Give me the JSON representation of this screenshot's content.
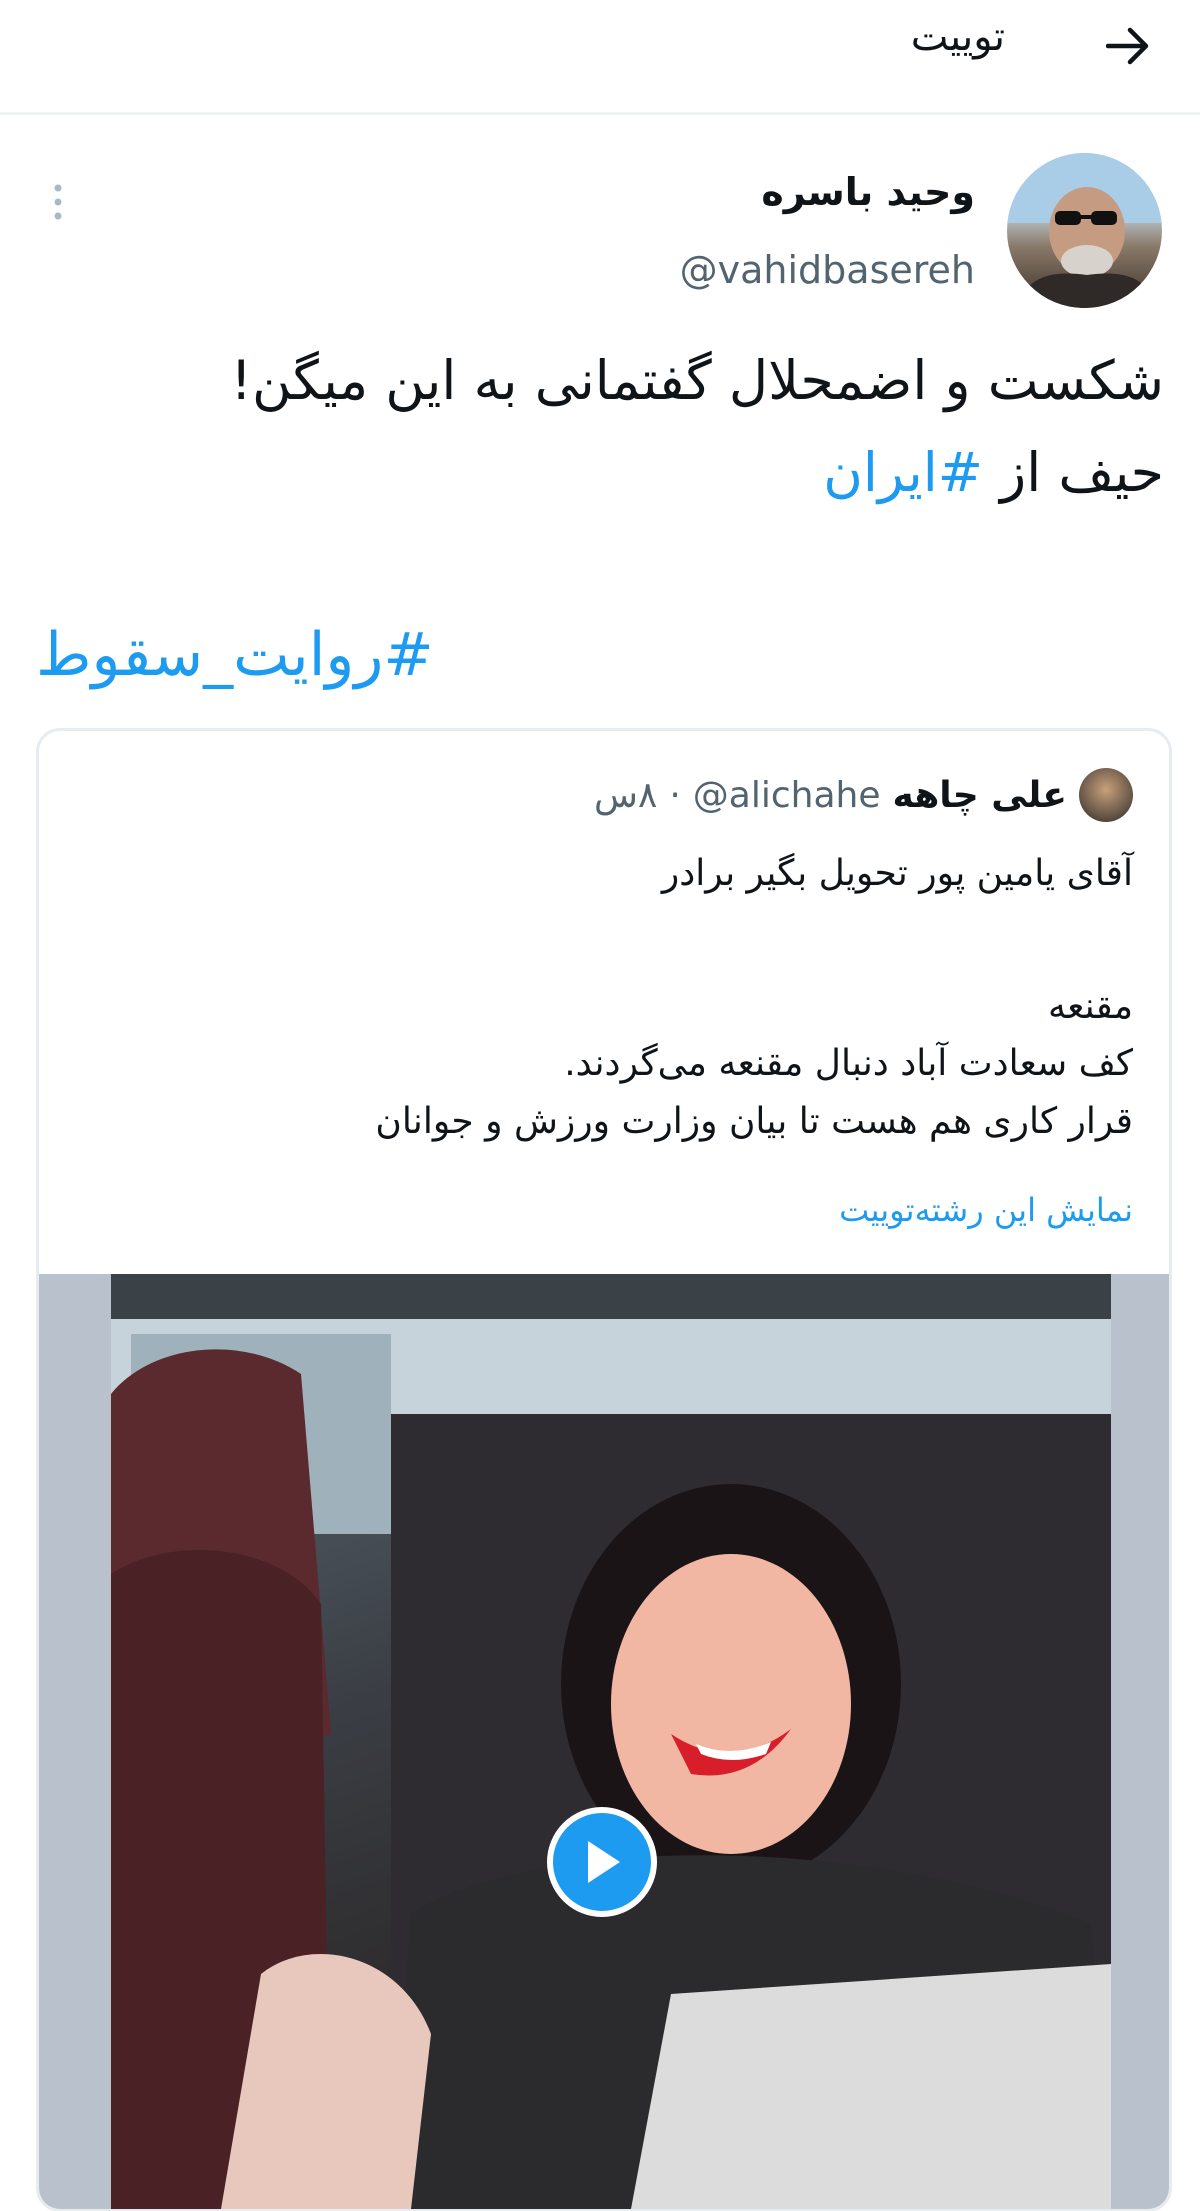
{
  "header": {
    "title": "توییت"
  },
  "author": {
    "name": "وحید باسره",
    "handle": "@vahidbasereh"
  },
  "tweet": {
    "line1": "شکست و اضمحلال گفتمانی به این میگن!",
    "line2_prefix": "حیف از",
    "hashtag1": "#ایران",
    "hashtag2": "#روایت_سقوط"
  },
  "quoted": {
    "name": "علی چاهه",
    "handle": "@alichahe",
    "separator": "·",
    "time": "۸س",
    "lines": [
      "آقای یامین پور تحویل بگیر برادر",
      "مقنعه",
      "کف سعادت آباد دنبال مقنعه می‌گردند.",
      "قرار کاری هم هست تا بیان وزارت ورزش و جوانان"
    ],
    "show_thread": "نمایش این رشته‌توییت"
  },
  "colors": {
    "accent": "#1d9bf0",
    "text": "#0f1419",
    "secondary": "#536471",
    "border": "#e6ecf0"
  },
  "icons": {
    "back": "arrow-right-icon",
    "more": "more-vertical-icon",
    "play": "play-icon"
  }
}
